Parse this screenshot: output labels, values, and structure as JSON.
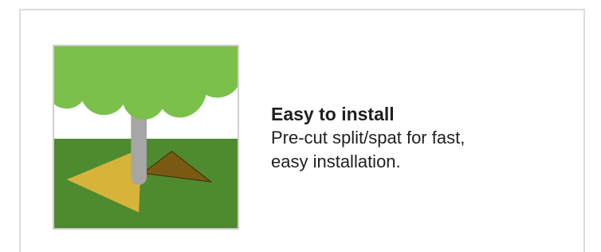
{
  "feature": {
    "title": "Easy to install",
    "description": "Pre-cut split/spat for fast,\neasy installation.",
    "icon": "tree-mat-illustration"
  },
  "colors": {
    "card_border": "#dcdcdc",
    "text": "#1f1f1f",
    "grass": "#4e8a2e",
    "foliage": "#7ac04a",
    "trunk": "#a6a6a6",
    "mat": "#d6b43a",
    "mat_split": "#7a5a12"
  }
}
